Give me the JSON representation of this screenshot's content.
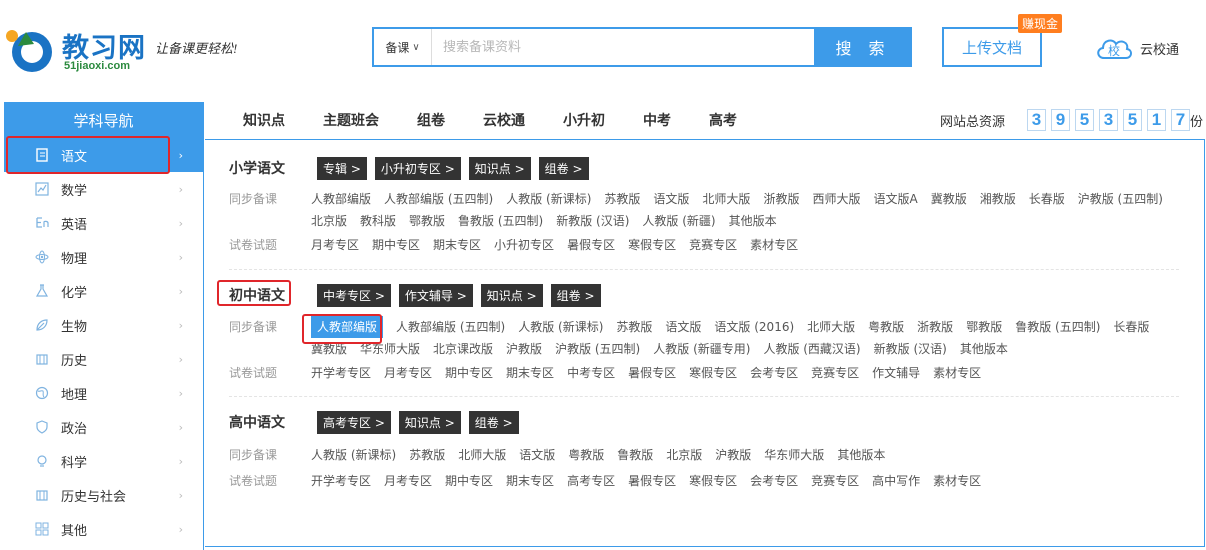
{
  "header": {
    "logo_title": "教习网",
    "logo_domain": "51jiaoxi.com",
    "slogan": "让备课更轻松!",
    "search_category": "备课",
    "search_placeholder": "搜索备课资料",
    "search_button": "搜 索",
    "upload_button": "上传文档",
    "earn_badge": "赚现金",
    "yxt_icon_text": "校",
    "yxt_label": "云校通"
  },
  "sidebar": {
    "title": "学科导航",
    "items": [
      {
        "label": "语文",
        "icon": "book-icon"
      },
      {
        "label": "数学",
        "icon": "chart-icon"
      },
      {
        "label": "英语",
        "icon": "english-icon"
      },
      {
        "label": "物理",
        "icon": "atom-icon"
      },
      {
        "label": "化学",
        "icon": "flask-icon"
      },
      {
        "label": "生物",
        "icon": "leaf-icon"
      },
      {
        "label": "历史",
        "icon": "scroll-icon"
      },
      {
        "label": "地理",
        "icon": "globe-icon"
      },
      {
        "label": "政治",
        "icon": "shield-icon"
      },
      {
        "label": "科学",
        "icon": "bulb-icon"
      },
      {
        "label": "历史与社会",
        "icon": "scroll-icon"
      },
      {
        "label": "其他",
        "icon": "grid-icon"
      }
    ]
  },
  "topnav": {
    "tabs": [
      "知识点",
      "主题班会",
      "组卷",
      "云校通",
      "小升初",
      "中考",
      "高考"
    ],
    "resource_label": "网站总资源",
    "resource_digits": [
      "3",
      "9",
      "5",
      "3",
      "5",
      "1",
      "7"
    ],
    "resource_unit": "份"
  },
  "sections": {
    "primary": {
      "title": "小学语文",
      "tags": [
        "专辑 >",
        "小升初专区 >",
        "知识点 >",
        "组卷 >"
      ],
      "sync_label": "同步备课",
      "sync_links": [
        "人教部编版",
        "人教部编版 (五四制)",
        "人教版 (新课标)",
        "苏教版",
        "语文版",
        "北师大版",
        "浙教版",
        "西师大版",
        "语文版A",
        "冀教版",
        "湘教版",
        "长春版",
        "沪教版 (五四制)",
        "北京版",
        "教科版",
        "鄂教版",
        "鲁教版 (五四制)",
        "新教版 (汉语)",
        "人教版 (新疆)",
        "其他版本"
      ],
      "exam_label": "试卷试题",
      "exam_links": [
        "月考专区",
        "期中专区",
        "期末专区",
        "小升初专区",
        "暑假专区",
        "寒假专区",
        "竞赛专区",
        "素材专区"
      ]
    },
    "junior": {
      "title": "初中语文",
      "tags": [
        "中考专区 >",
        "作文辅导 >",
        "知识点 >",
        "组卷 >"
      ],
      "sync_label": "同步备课",
      "sync_links": [
        "人教部编版",
        "人教部编版 (五四制)",
        "人教版 (新课标)",
        "苏教版",
        "语文版",
        "语文版 (2016)",
        "北师大版",
        "粤教版",
        "浙教版",
        "鄂教版",
        "鲁教版 (五四制)",
        "长春版",
        "冀教版",
        "华东师大版",
        "北京课改版",
        "沪教版",
        "沪教版 (五四制)",
        "人教版 (新疆专用)",
        "人教版 (西藏汉语)",
        "新教版 (汉语)",
        "其他版本"
      ],
      "exam_label": "试卷试题",
      "exam_links": [
        "开学考专区",
        "月考专区",
        "期中专区",
        "期末专区",
        "中考专区",
        "暑假专区",
        "寒假专区",
        "会考专区",
        "竞赛专区",
        "作文辅导",
        "素材专区"
      ]
    },
    "senior": {
      "title": "高中语文",
      "tags": [
        "高考专区 >",
        "知识点 >",
        "组卷 >"
      ],
      "sync_label": "同步备课",
      "sync_links": [
        "人教版 (新课标)",
        "苏教版",
        "北师大版",
        "语文版",
        "粤教版",
        "鲁教版",
        "北京版",
        "沪教版",
        "华东师大版",
        "其他版本"
      ],
      "exam_label": "试卷试题",
      "exam_links": [
        "开学考专区",
        "月考专区",
        "期中专区",
        "期末专区",
        "高考专区",
        "暑假专区",
        "寒假专区",
        "会考专区",
        "竞赛专区",
        "高中写作",
        "素材专区"
      ]
    }
  },
  "colors": {
    "accent": "#3d9be9",
    "highlight_box": "#e0262b",
    "badge": "#ff7e1f",
    "tag_bg": "#333333"
  }
}
